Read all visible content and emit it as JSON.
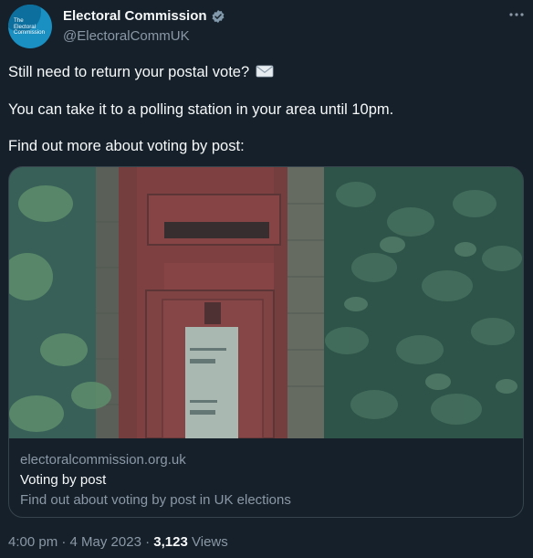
{
  "author": {
    "display_name": "Electoral Commission",
    "handle": "@ElectoralCommUK",
    "avatar_text": [
      "The",
      "Electoral",
      "Commission"
    ],
    "verified": true,
    "verified_color": "#829aab"
  },
  "icons": {
    "more": "more-options-icon",
    "verified": "verified-badge-icon",
    "mail": "envelope-icon"
  },
  "tweet": {
    "line1": "Still need to return your postal vote?",
    "line2": "You can take it to a polling station in your area until 10pm.",
    "line3": "Find out more about voting by post:"
  },
  "card": {
    "domain": "electoralcommission.org.uk",
    "title": "Voting by post",
    "description": "Find out about voting by post in UK elections"
  },
  "meta": {
    "time": "4:00 pm",
    "separator": "·",
    "date": "4 May 2023",
    "views_count": "3,123",
    "views_label": "Views"
  },
  "colors": {
    "background": "#15202b",
    "primary_text": "#f7f9f9",
    "secondary_text": "#8b98a5",
    "border": "#38444d",
    "brand": "#1a8fc1"
  }
}
